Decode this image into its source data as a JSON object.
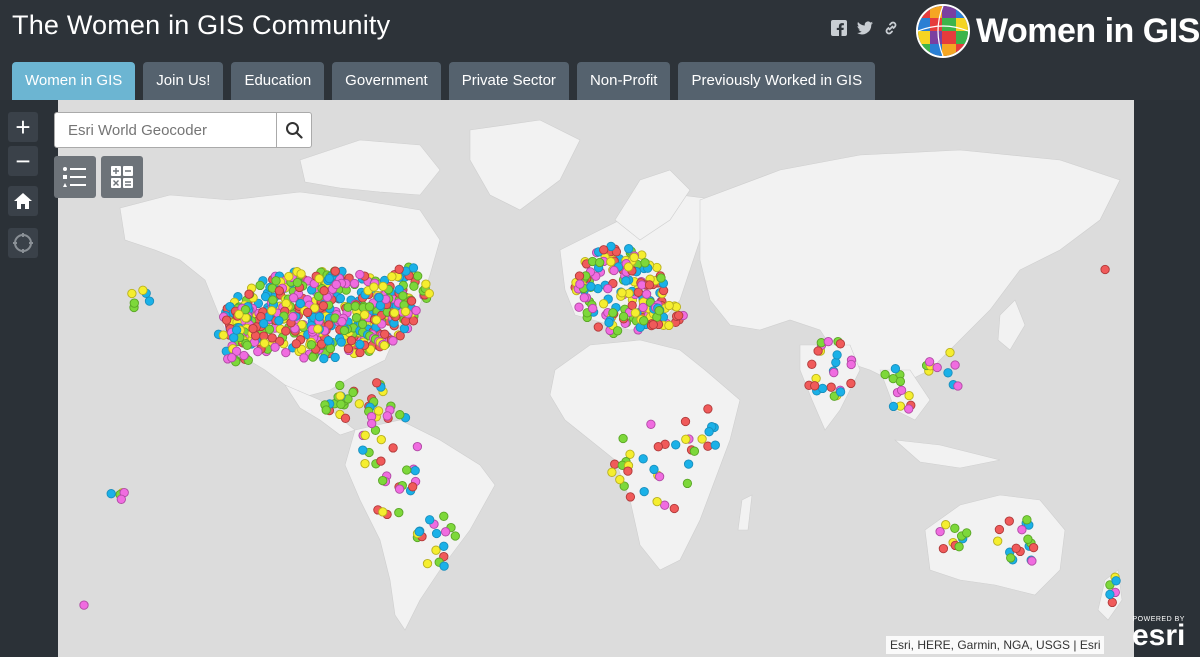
{
  "header": {
    "title": "The Women in GIS Community",
    "brand_name": "Women in GIS",
    "social_icons": [
      "facebook-icon",
      "twitter-icon",
      "link-icon"
    ]
  },
  "tabs": [
    {
      "label": "Women in GIS",
      "active": true
    },
    {
      "label": "Join Us!",
      "active": false
    },
    {
      "label": "Education",
      "active": false
    },
    {
      "label": "Government",
      "active": false
    },
    {
      "label": "Private Sector",
      "active": false
    },
    {
      "label": "Non-Profit",
      "active": false
    },
    {
      "label": "Previously Worked in GIS",
      "active": false
    }
  ],
  "map_controls": {
    "zoom_in": "+",
    "zoom_out": "−",
    "home_icon": "home-icon",
    "locate_icon": "locate-icon",
    "legend_icon": "legend-list-icon",
    "basemap_icon": "calculator-grid-icon"
  },
  "search": {
    "placeholder": "Esri World Geocoder",
    "button_icon": "search-icon"
  },
  "map": {
    "attribution": "Esri, HERE, Garmin, NGA, USGS | Esri",
    "logo_powered": "POWERED BY",
    "logo_name": "esri",
    "marker_colors": [
      "#1ab1e8",
      "#f05a5a",
      "#f5ee2f",
      "#7dd83a",
      "#f06ce0"
    ]
  },
  "colors": {
    "header_bg": "#2d3339",
    "tab_active": "#6cb5d2",
    "tab_inactive": "#55626e",
    "map_bg": "#dcdcdc",
    "land": "#f2f2f2"
  }
}
